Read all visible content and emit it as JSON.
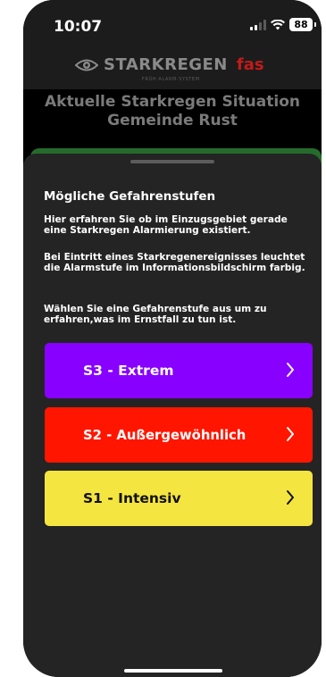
{
  "status_bar": {
    "time": "10:07",
    "battery": "88"
  },
  "header": {
    "logo_text": "STARKREGEN",
    "logo_brand": "fas",
    "logo_sub": "FRÜH·ALARM·SYSTEM"
  },
  "background": {
    "title_line1": "Aktuelle Starkregen Situation",
    "title_line2": "Gemeinde Rust",
    "status_color": "#256b2c"
  },
  "sheet": {
    "title": "Mögliche Gefahrenstufen",
    "paragraph1": "Hier erfahren Sie ob im Einzugsgebiet gerade eine Starkregen Alarmierung existiert.",
    "paragraph2": "Bei Eintritt eines Starkregenereignisses leuchtet die Alarmstufe im Informationsbildschirm farbig.",
    "paragraph3": "Wählen Sie eine Gefahrenstufe aus um zu erfahren,was im Ernstfall zu tun ist.",
    "levels": [
      {
        "label": "S3 - Extrem",
        "color": "#8800ff",
        "icon": "chevron-right-icon"
      },
      {
        "label": "S2 - Außergewöhnlich",
        "color": "#ff1500",
        "icon": "chevron-right-icon"
      },
      {
        "label": "S1 - Intensiv",
        "color": "#f5e540",
        "icon": "chevron-right-icon"
      }
    ]
  }
}
